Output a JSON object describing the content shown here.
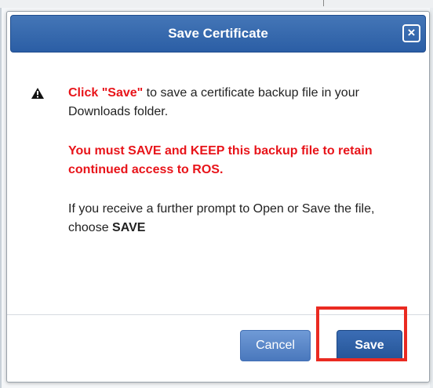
{
  "dialog": {
    "title": "Save Certificate",
    "close_label": "×",
    "message": {
      "line1_highlight": "Click \"Save\"",
      "line1_rest": " to save a certificate backup file in your Downloads folder.",
      "warning": "You must SAVE and KEEP this backup file to retain continued access to ROS.",
      "prompt_prefix": "If you receive a further prompt to Open or Save the file, choose ",
      "prompt_action": "SAVE"
    },
    "buttons": {
      "cancel_label": "Cancel",
      "save_label": "Save"
    }
  },
  "icons": {
    "close": "close-icon",
    "warning": "warning-triangle-icon"
  },
  "colors": {
    "titlebar": "#2b5ea5",
    "warning_text": "#e8141a",
    "save_button": "#245496",
    "cancel_button": "#4a78bd",
    "highlight_box": "#ea2a21"
  }
}
